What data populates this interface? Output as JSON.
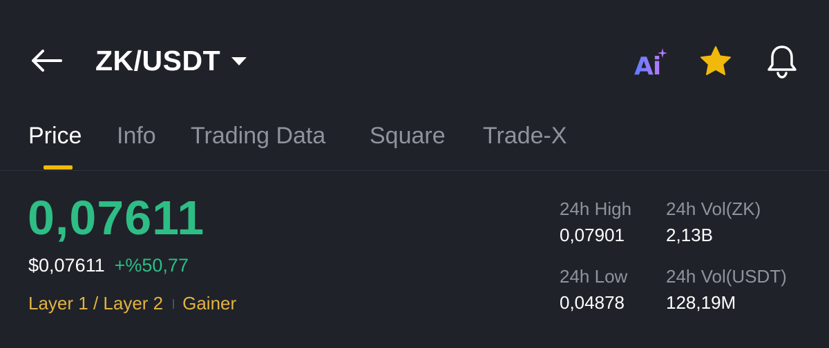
{
  "header": {
    "pair": "ZK/USDT",
    "icons": {
      "back": "arrow-left-icon",
      "caret": "caret-down-icon",
      "ai": "ai-assistant-icon",
      "favorite": "star-icon",
      "alert": "bell-icon"
    },
    "ai_label": "Ai"
  },
  "tabs": [
    {
      "label": "Price",
      "active": true
    },
    {
      "label": "Info",
      "active": false
    },
    {
      "label": "Trading Data",
      "active": false
    },
    {
      "label": "Square",
      "active": false
    },
    {
      "label": "Trade-X",
      "active": false
    }
  ],
  "price": {
    "last": "0,07611",
    "usd": "$0,07611",
    "change": "+%50,77"
  },
  "tags": [
    "Layer 1 / Layer 2",
    "Gainer"
  ],
  "stats": {
    "high_label": "24h High",
    "high_value": "0,07901",
    "vol_base_label": "24h Vol(ZK)",
    "vol_base_value": "2,13B",
    "low_label": "24h Low",
    "low_value": "0,04878",
    "vol_quote_label": "24h Vol(USDT)",
    "vol_quote_value": "128,19M"
  },
  "colors": {
    "background": "#1f2229",
    "up": "#2ebd85",
    "accent": "#f0b90b",
    "tag": "#e3b341",
    "muted": "#8e939c"
  }
}
